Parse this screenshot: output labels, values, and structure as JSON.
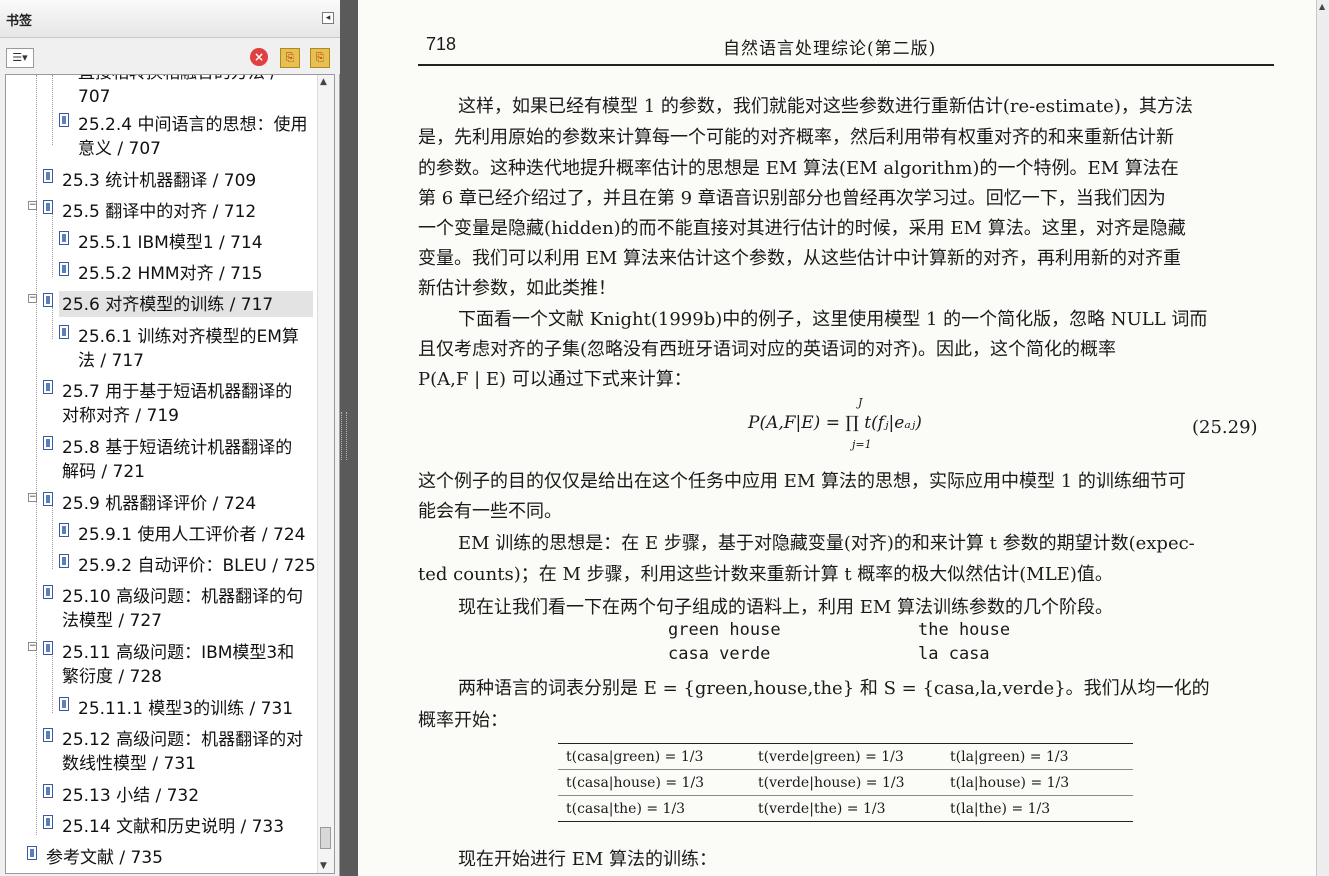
{
  "sidebar": {
    "title": "书签",
    "collapse_icon": "◂",
    "options_label": "☰▾",
    "delete_icon": "×",
    "new_icon": "⎘",
    "expand_icon": "⎘",
    "items": [
      {
        "lines": [
          "直接相转换相融合的方法 /",
          "707"
        ]
      },
      {
        "lines": [
          "25.2.4 中间语言的思想：使用",
          "意义 / 707"
        ]
      },
      {
        "lines": [
          "25.3 统计机器翻译 / 709"
        ]
      },
      {
        "lines": [
          "25.5 翻译中的对齐 / 712"
        ]
      },
      {
        "lines": [
          "25.5.1 IBM模型1 / 714"
        ]
      },
      {
        "lines": [
          "25.5.2 HMM对齐 / 715"
        ]
      },
      {
        "lines": [
          "25.6 对齐模型的训练 / 717"
        ]
      },
      {
        "lines": [
          "25.6.1 训练对齐模型的EM算",
          "法 / 717"
        ]
      },
      {
        "lines": [
          "25.7 用于基于短语机器翻译的",
          "对称对齐 / 719"
        ]
      },
      {
        "lines": [
          "25.8 基于短语统计机器翻译的",
          "解码 / 721"
        ]
      },
      {
        "lines": [
          "25.9 机器翻译评价 / 724"
        ]
      },
      {
        "lines": [
          "25.9.1 使用人工评价者 / 724"
        ]
      },
      {
        "lines": [
          "25.9.2 自动评价：BLEU / 725"
        ]
      },
      {
        "lines": [
          "25.10 高级问题：机器翻译的句",
          "法模型 / 727"
        ]
      },
      {
        "lines": [
          "25.11 高级问题：IBM模型3和",
          "繁衍度 / 728"
        ]
      },
      {
        "lines": [
          "25.11.1 模型3的训练 / 731"
        ]
      },
      {
        "lines": [
          "25.12 高级问题：机器翻译的对",
          "数线性模型 / 731"
        ]
      },
      {
        "lines": [
          "25.13 小结 / 732"
        ]
      },
      {
        "lines": [
          "25.14 文献和历史说明 / 733"
        ]
      },
      {
        "lines": [
          "参考文献 / 735"
        ]
      }
    ],
    "toggle_label": "−"
  },
  "page": {
    "number": "718",
    "running_head": "自然语言处理综论(第二版)",
    "para1": [
      "这样，如果已经有模型 1 的参数，我们就能对这些参数进行重新估计(re-estimate)，其方法",
      "是，先利用原始的参数来计算每一个可能的对齐概率，然后利用带有权重对齐的和来重新估计新",
      "的参数。这种迭代地提升概率估计的思想是 EM 算法(EM algorithm)的一个特例。EM 算法在",
      "第 6 章已经介绍过了，并且在第 9 章语音识别部分也曾经再次学习过。回忆一下，当我们因为",
      "一个变量是隐藏(hidden)的而不能直接对其进行估计的时候，采用 EM 算法。这里，对齐是隐藏",
      "变量。我们可以利用 EM 算法来估计这个参数，从这些估计中计算新的对齐，再利用新的对齐重",
      "新估计参数，如此类推！"
    ],
    "para2": [
      "下面看一个文献 Knight(1999b)中的例子，这里使用模型 1 的一个简化版，忽略 NULL 词而",
      "且仅考虑对齐的子集(忽略没有西班牙语词对应的英语词的对齐)。因此，这个简化的概率",
      "P(A,F | E) 可以通过下式来计算："
    ],
    "equation": "P(A,F|E) = ∏ t(fⱼ|eₐⱼ)",
    "eq_sup": "J",
    "eq_sub": "j=1",
    "eq_number": "(25.29)",
    "para3": [
      "这个例子的目的仅仅是给出在这个任务中应用 EM 算法的思想，实际应用中模型 1 的训练细节可",
      "能会有一些不同。"
    ],
    "para4": [
      "EM 训练的思想是：在 E 步骤，基于对隐藏变量(对齐)的和来计算 t 参数的期望计数(expec-",
      "ted counts)；在 M 步骤，利用这些计数来重新计算 t 概率的极大似然估计(MLE)值。"
    ],
    "para5": "现在让我们看一下在两个句子组成的语料上，利用 EM 算法训练参数的几个阶段。",
    "corpus": {
      "en1": "green house",
      "es1": "casa verde",
      "en2": "the house",
      "es2": "la casa"
    },
    "para6": [
      "两种语言的词表分别是 E = {green,house,the} 和 S = {casa,la,verde}。我们从均一化的",
      "概率开始："
    ],
    "table": [
      [
        "t(casa|green) = 1/3",
        "t(verde|green) = 1/3",
        "t(la|green) = 1/3"
      ],
      [
        "t(casa|house) = 1/3",
        "t(verde|house) = 1/3",
        "t(la|house) = 1/3"
      ],
      [
        "t(casa|the) = 1/3",
        "t(verde|the) = 1/3",
        "t(la|the) = 1/3"
      ]
    ],
    "para7": "现在开始进行 EM 算法的训练："
  }
}
